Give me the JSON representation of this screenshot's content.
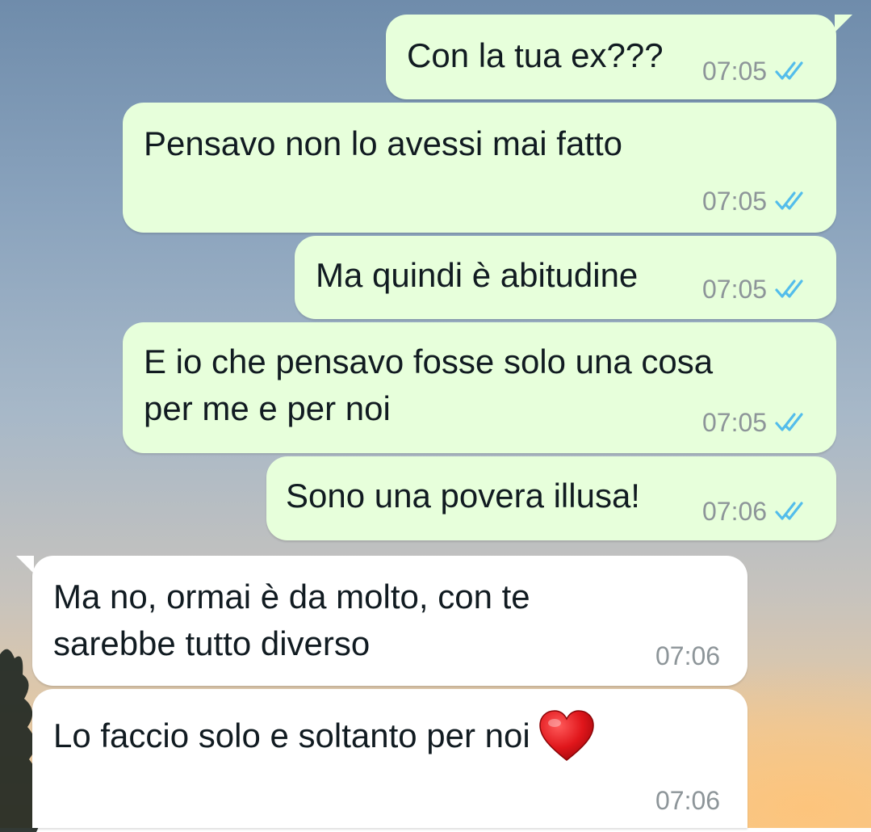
{
  "messages": [
    {
      "id": "m1",
      "direction": "outgoing",
      "text": "Con la tua ex???",
      "time": "07:05",
      "status": "read"
    },
    {
      "id": "m2",
      "direction": "outgoing",
      "text": "Pensavo non lo avessi mai fatto",
      "time": "07:05",
      "status": "read"
    },
    {
      "id": "m3",
      "direction": "outgoing",
      "text": "Ma quindi è abitudine",
      "time": "07:05",
      "status": "read"
    },
    {
      "id": "m4",
      "direction": "outgoing",
      "text": "E io che pensavo fosse solo una cosa\nper me e per noi",
      "time": "07:05",
      "status": "read"
    },
    {
      "id": "m5",
      "direction": "outgoing",
      "text": "Sono una povera illusa!",
      "time": "07:06",
      "status": "read"
    },
    {
      "id": "m6",
      "direction": "incoming",
      "text": "Ma no, ormai è da molto, con te\nsarebbe tutto diverso",
      "time": "07:06"
    },
    {
      "id": "m7",
      "direction": "incoming",
      "text": "Lo faccio solo e soltanto per noi",
      "time": "07:06",
      "emoji": "red-heart"
    }
  ],
  "colors": {
    "outgoing_bubble": "#e7ffdb",
    "incoming_bubble": "#ffffff",
    "read_ticks": "#53bdeb",
    "time_text": "#8d9599",
    "message_text": "#111b21"
  },
  "icons": {
    "read_status": "double-check-icon",
    "emoji": "red-heart-icon"
  }
}
